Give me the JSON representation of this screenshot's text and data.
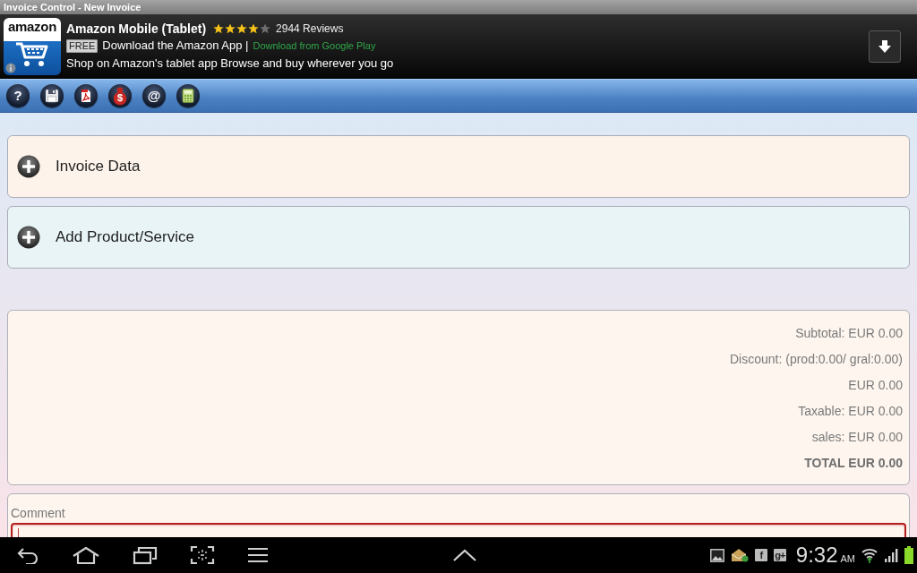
{
  "window": {
    "title": "Invoice Control - New Invoice"
  },
  "ad": {
    "logo_text": "amazon",
    "app_name": "Amazon Mobile (Tablet)",
    "stars": 4,
    "reviews": "2944 Reviews",
    "price_badge": "FREE",
    "headline": "Download the Amazon App |",
    "store_link": "Download from Google Play",
    "description": "Shop on Amazon's tablet app Browse and buy wherever you go"
  },
  "toolbar": [
    {
      "kind": "help",
      "glyph": "?"
    },
    {
      "kind": "save"
    },
    {
      "kind": "pdf"
    },
    {
      "kind": "money",
      "glyph": "$"
    },
    {
      "kind": "email",
      "glyph": "@"
    },
    {
      "kind": "calculator"
    }
  ],
  "sections": [
    {
      "title": "Invoice Data",
      "expanded": false
    },
    {
      "title": "Add Product/Service",
      "expanded": false
    }
  ],
  "totals": [
    {
      "kind": "line",
      "text": "Subtotal: EUR 0.00"
    },
    {
      "kind": "line",
      "text": "Discount: (prod:0.00/ gral:0.00)"
    },
    {
      "kind": "line",
      "text": "EUR 0.00"
    },
    {
      "kind": "line",
      "text": "Taxable: EUR 0.00"
    },
    {
      "kind": "line",
      "text": "sales: EUR 0.00"
    },
    {
      "kind": "total",
      "text": "TOTAL EUR 0.00"
    }
  ],
  "comment": {
    "label": "Comment",
    "focused": true
  },
  "status_bar": {
    "notifications": [
      {
        "kind": "picture"
      },
      {
        "kind": "mail"
      },
      {
        "kind": "letter",
        "glyph": "f"
      },
      {
        "kind": "letter",
        "glyph": "g+"
      }
    ],
    "time": "9:32",
    "meridiem": "AM"
  }
}
